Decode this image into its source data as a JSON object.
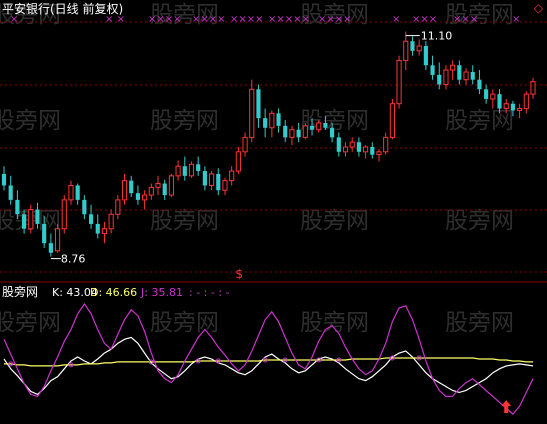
{
  "header": {
    "title": "平安银行(日线 前复权)",
    "diamond": "◇"
  },
  "colors": {
    "up": "#ff3333",
    "down": "#33cccc",
    "grid": "#8b0000",
    "k": "#ffffff",
    "d": "#ffff66",
    "j": "#cc33cc",
    "marker": "#cc33cc",
    "signal": "#ff3333"
  },
  "watermark": "股旁网",
  "price_panel": {
    "high_label": "11.10",
    "low_label": "8.76",
    "signal_label": "$",
    "top_marks": [
      "×",
      "× ×",
      "××××",
      "××××",
      "××××",
      "×××××",
      "××××",
      "×",
      "×××",
      "×××",
      "×"
    ]
  },
  "indicator_panel": {
    "name": "股旁网",
    "k_label": "K: 43.04",
    "d_label": "D: 46.66",
    "j_label": "J: 35.81",
    "extra": ": -  : -  : -"
  },
  "chart_data": [
    {
      "type": "candlestick",
      "title": "平安银行(日线 前复权)",
      "ylim": [
        8.6,
        11.2
      ],
      "grid": true,
      "annotations": [
        "11.10",
        "8.76"
      ],
      "ohlc": [
        [
          9.62,
          9.7,
          9.45,
          9.5
        ],
        [
          9.5,
          9.6,
          9.3,
          9.35
        ],
        [
          9.35,
          9.45,
          9.15,
          9.2
        ],
        [
          9.2,
          9.25,
          9.0,
          9.05
        ],
        [
          9.05,
          9.3,
          9.0,
          9.25
        ],
        [
          9.25,
          9.32,
          9.05,
          9.1
        ],
        [
          9.1,
          9.18,
          8.85,
          8.9
        ],
        [
          8.9,
          9.0,
          8.76,
          8.8
        ],
        [
          8.82,
          9.1,
          8.8,
          9.05
        ],
        [
          9.05,
          9.4,
          9.0,
          9.35
        ],
        [
          9.35,
          9.55,
          9.3,
          9.5
        ],
        [
          9.5,
          9.52,
          9.3,
          9.35
        ],
        [
          9.35,
          9.4,
          9.15,
          9.2
        ],
        [
          9.2,
          9.3,
          9.05,
          9.1
        ],
        [
          9.1,
          9.2,
          8.95,
          9.0
        ],
        [
          9.0,
          9.12,
          8.9,
          9.05
        ],
        [
          9.05,
          9.25,
          9.0,
          9.2
        ],
        [
          9.2,
          9.4,
          9.15,
          9.35
        ],
        [
          9.35,
          9.62,
          9.3,
          9.55
        ],
        [
          9.55,
          9.6,
          9.38,
          9.42
        ],
        [
          9.42,
          9.5,
          9.3,
          9.35
        ],
        [
          9.35,
          9.45,
          9.25,
          9.4
        ],
        [
          9.4,
          9.52,
          9.35,
          9.48
        ],
        [
          9.48,
          9.6,
          9.4,
          9.52
        ],
        [
          9.52,
          9.56,
          9.35,
          9.4
        ],
        [
          9.4,
          9.62,
          9.38,
          9.6
        ],
        [
          9.6,
          9.76,
          9.55,
          9.7
        ],
        [
          9.7,
          9.8,
          9.55,
          9.6
        ],
        [
          9.6,
          9.75,
          9.58,
          9.72
        ],
        [
          9.72,
          9.8,
          9.6,
          9.65
        ],
        [
          9.65,
          9.7,
          9.45,
          9.5
        ],
        [
          9.5,
          9.65,
          9.45,
          9.62
        ],
        [
          9.62,
          9.68,
          9.4,
          9.45
        ],
        [
          9.45,
          9.58,
          9.4,
          9.55
        ],
        [
          9.55,
          9.7,
          9.5,
          9.65
        ],
        [
          9.65,
          9.9,
          9.62,
          9.85
        ],
        [
          9.85,
          10.05,
          9.8,
          10.0
        ],
        [
          10.0,
          10.6,
          9.95,
          10.5
        ],
        [
          10.5,
          10.55,
          10.1,
          10.2
        ],
        [
          10.2,
          10.3,
          10.0,
          10.1
        ],
        [
          10.1,
          10.28,
          10.0,
          10.25
        ],
        [
          10.25,
          10.3,
          10.05,
          10.12
        ],
        [
          10.12,
          10.18,
          9.95,
          10.0
        ],
        [
          10.0,
          10.12,
          9.92,
          10.08
        ],
        [
          10.08,
          10.15,
          9.95,
          10.0
        ],
        [
          10.0,
          10.15,
          9.98,
          10.12
        ],
        [
          10.12,
          10.2,
          10.02,
          10.08
        ],
        [
          10.08,
          10.18,
          10.05,
          10.15
        ],
        [
          10.15,
          10.22,
          10.08,
          10.1
        ],
        [
          10.1,
          10.15,
          9.95,
          10.0
        ],
        [
          10.0,
          10.05,
          9.8,
          9.85
        ],
        [
          9.85,
          9.95,
          9.8,
          9.9
        ],
        [
          9.9,
          10.0,
          9.85,
          9.95
        ],
        [
          9.95,
          10.0,
          9.8,
          9.85
        ],
        [
          9.85,
          9.92,
          9.78,
          9.9
        ],
        [
          9.9,
          9.95,
          9.78,
          9.82
        ],
        [
          9.82,
          9.88,
          9.75,
          9.85
        ],
        [
          9.85,
          10.05,
          9.82,
          10.0
        ],
        [
          10.0,
          10.4,
          9.98,
          10.35
        ],
        [
          10.35,
          10.85,
          10.3,
          10.8
        ],
        [
          10.8,
          11.1,
          10.7,
          11.0
        ],
        [
          11.0,
          11.05,
          10.85,
          10.9
        ],
        [
          10.9,
          11.02,
          10.85,
          10.95
        ],
        [
          10.95,
          11.0,
          10.7,
          10.75
        ],
        [
          10.75,
          10.85,
          10.6,
          10.65
        ],
        [
          10.65,
          10.78,
          10.5,
          10.55
        ],
        [
          10.55,
          10.75,
          10.5,
          10.7
        ],
        [
          10.7,
          10.8,
          10.6,
          10.75
        ],
        [
          10.75,
          10.8,
          10.55,
          10.6
        ],
        [
          10.6,
          10.72,
          10.55,
          10.68
        ],
        [
          10.68,
          10.75,
          10.55,
          10.6
        ],
        [
          10.6,
          10.7,
          10.45,
          10.5
        ],
        [
          10.5,
          10.55,
          10.35,
          10.4
        ],
        [
          10.4,
          10.5,
          10.3,
          10.45
        ],
        [
          10.45,
          10.5,
          10.25,
          10.3
        ],
        [
          10.3,
          10.4,
          10.25,
          10.35
        ],
        [
          10.35,
          10.38,
          10.22,
          10.28
        ],
        [
          10.28,
          10.35,
          10.2,
          10.3
        ],
        [
          10.3,
          10.48,
          10.25,
          10.45
        ],
        [
          10.45,
          10.62,
          10.4,
          10.58
        ]
      ]
    },
    {
      "type": "line",
      "title": "",
      "ylim": [
        -10,
        110
      ],
      "series": [
        {
          "name": "K",
          "values": [
            50,
            40,
            33,
            25,
            17,
            14,
            20,
            28,
            32,
            40,
            48,
            52,
            48,
            45,
            50,
            56,
            60,
            66,
            70,
            72,
            66,
            56,
            46,
            40,
            35,
            30,
            32,
            38,
            45,
            50,
            52,
            50,
            46,
            44,
            40,
            36,
            34,
            38,
            45,
            52,
            55,
            50,
            46,
            40,
            36,
            38,
            44,
            50,
            52,
            50,
            46,
            40,
            35,
            30,
            28,
            32,
            38,
            44,
            52,
            56,
            58,
            52,
            44,
            36,
            30,
            26,
            22,
            18,
            16,
            18,
            22,
            26,
            30,
            36,
            40,
            43,
            44,
            45,
            44,
            43
          ]
        },
        {
          "name": "D",
          "values": [
            45,
            45,
            44,
            44,
            43,
            43,
            43,
            43,
            43,
            44,
            44,
            44,
            45,
            45,
            45,
            46,
            46,
            47,
            47,
            47,
            47,
            47,
            47,
            47,
            47,
            47,
            47,
            47,
            47,
            48,
            48,
            48,
            48,
            48,
            48,
            48,
            48,
            48,
            48,
            49,
            49,
            49,
            49,
            49,
            49,
            49,
            49,
            49,
            49,
            49,
            49,
            49,
            50,
            50,
            50,
            50,
            50,
            51,
            51,
            51,
            51,
            51,
            51,
            51,
            51,
            51,
            51,
            51,
            51,
            51,
            51,
            50,
            50,
            50,
            49,
            49,
            48,
            48,
            47,
            47
          ]
        },
        {
          "name": "J",
          "values": [
            70,
            55,
            40,
            25,
            14,
            12,
            22,
            38,
            52,
            68,
            80,
            96,
            106,
            96,
            80,
            66,
            60,
            75,
            90,
            100,
            94,
            78,
            56,
            38,
            30,
            26,
            34,
            48,
            60,
            72,
            80,
            72,
            62,
            54,
            45,
            38,
            44,
            58,
            74,
            90,
            98,
            88,
            72,
            56,
            44,
            40,
            52,
            68,
            80,
            84,
            76,
            62,
            50,
            40,
            34,
            38,
            50,
            66,
            88,
            102,
            104,
            90,
            70,
            48,
            30,
            18,
            12,
            12,
            20,
            26,
            30,
            24,
            18,
            12,
            6,
            0,
            -6,
            2,
            16,
            30
          ]
        }
      ]
    }
  ]
}
